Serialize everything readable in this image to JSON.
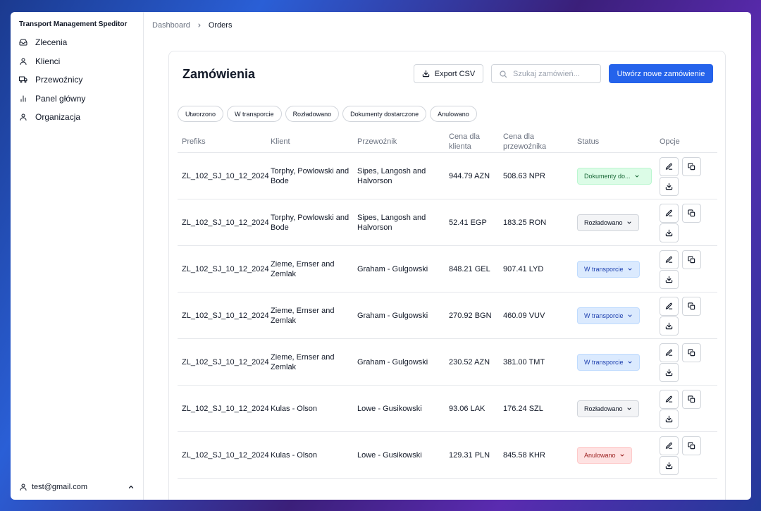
{
  "sidebar": {
    "app_title": "Transport Management Speditor",
    "items": [
      {
        "label": "Zlecenia",
        "icon": "inbox-icon"
      },
      {
        "label": "Klienci",
        "icon": "user-icon"
      },
      {
        "label": "Przewoźnicy",
        "icon": "truck-icon"
      },
      {
        "label": "Panel główny",
        "icon": "bar-chart-icon"
      },
      {
        "label": "Organizacja",
        "icon": "user-icon"
      }
    ],
    "user_email": "test@gmail.com"
  },
  "breadcrumb": {
    "root": "Dashboard",
    "current": "Orders"
  },
  "page": {
    "title": "Zamówienia",
    "export_label": "Export CSV",
    "search_placeholder": "Szukaj zamówień...",
    "create_label": "Utwórz nowe zamówienie",
    "filters": [
      "Utworzono",
      "W transporcie",
      "Rozładowano",
      "Dokumenty dostarczone",
      "Anulowano"
    ]
  },
  "table": {
    "headers": {
      "prefix": "Prefiks",
      "client": "Klient",
      "carrier": "Przewoźnik",
      "price_client": "Cena dla klienta",
      "price_carrier": "Cena dla przewoźnika",
      "status": "Status",
      "options": "Opcje"
    },
    "rows": [
      {
        "prefix": "ZL_102_SJ_10_12_2024",
        "client": "Torphy, Powlowski and Bode",
        "carrier": "Sipes, Langosh and Halvorson",
        "price_client": "944.79 AZN",
        "price_carrier": "508.63 NPR",
        "status": "Dokumenty do...",
        "status_color": "green"
      },
      {
        "prefix": "ZL_102_SJ_10_12_2024",
        "client": "Torphy, Powlowski and Bode",
        "carrier": "Sipes, Langosh and Halvorson",
        "price_client": "52.41 EGP",
        "price_carrier": "183.25 RON",
        "status": "Rozładowano",
        "status_color": "gray"
      },
      {
        "prefix": "ZL_102_SJ_10_12_2024",
        "client": "Zieme, Ernser and Zemlak",
        "carrier": "Graham - Gulgowski",
        "price_client": "848.21 GEL",
        "price_carrier": "907.41 LYD",
        "status": "W transporcie",
        "status_color": "blue"
      },
      {
        "prefix": "ZL_102_SJ_10_12_2024",
        "client": "Zieme, Ernser and Zemlak",
        "carrier": "Graham - Gulgowski",
        "price_client": "270.92 BGN",
        "price_carrier": "460.09 VUV",
        "status": "W transporcie",
        "status_color": "blue"
      },
      {
        "prefix": "ZL_102_SJ_10_12_2024",
        "client": "Zieme, Ernser and Zemlak",
        "carrier": "Graham - Gulgowski",
        "price_client": "230.52 AZN",
        "price_carrier": "381.00 TMT",
        "status": "W transporcie",
        "status_color": "blue"
      },
      {
        "prefix": "ZL_102_SJ_10_12_2024",
        "client": "Kulas - Olson",
        "carrier": "Lowe - Gusikowski",
        "price_client": "93.06 LAK",
        "price_carrier": "176.24 SZL",
        "status": "Rozładowano",
        "status_color": "gray"
      },
      {
        "prefix": "ZL_102_SJ_10_12_2024",
        "client": "Kulas - Olson",
        "carrier": "Lowe - Gusikowski",
        "price_client": "129.31 PLN",
        "price_carrier": "845.58 KHR",
        "status": "Anulowano",
        "status_color": "red"
      }
    ]
  }
}
